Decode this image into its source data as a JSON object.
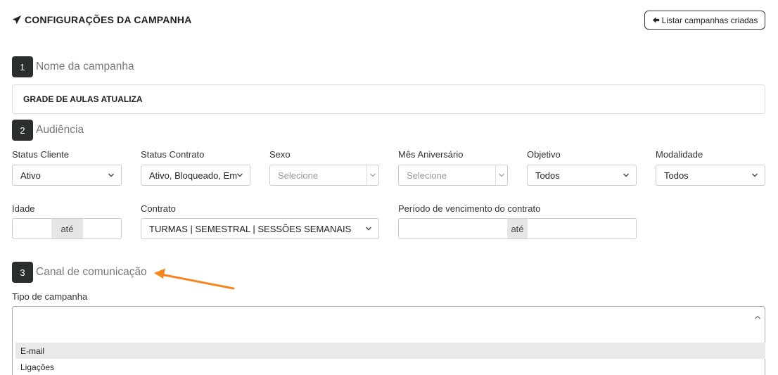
{
  "header": {
    "icon": "paper-plane-icon",
    "title": "CONFIGURAÇÕES DA CAMPANHA"
  },
  "list_button": {
    "icon": "arrow-left-icon",
    "label": "Listar campanhas criadas"
  },
  "steps": [
    {
      "number": "1",
      "title": "Nome da campanha"
    },
    {
      "number": "2",
      "title": "Audiência"
    },
    {
      "number": "3",
      "title": "Canal de comunicação"
    }
  ],
  "campaign_name": {
    "value": "GRADE DE AULAS ATUALIZA"
  },
  "audience": {
    "status_cliente": {
      "label": "Status Cliente",
      "value": "Ativo"
    },
    "status_contrato": {
      "label": "Status Contrato",
      "value": "Ativo, Bloqueado, Em"
    },
    "sexo": {
      "label": "Sexo",
      "placeholder": "Selecione"
    },
    "mes_aniversario": {
      "label": "Mês Aniversário",
      "placeholder": "Selecione"
    },
    "objetivo": {
      "label": "Objetivo",
      "value": "Todos"
    },
    "modalidade": {
      "label": "Modalidade",
      "value": "Todos"
    },
    "idade": {
      "label": "Idade",
      "separator": "até"
    },
    "contrato": {
      "label": "Contrato",
      "value": "TURMAS | SEMESTRAL | SESSÕES SEMANAIS"
    },
    "periodo": {
      "label": "Período de vencimento do contrato",
      "separator": "até"
    }
  },
  "channel": {
    "tipo_label": "Tipo de campanha",
    "options": [
      "E-mail",
      "Ligações"
    ],
    "highlighted_option": "E-mail"
  },
  "colors": {
    "step_badge": "#2b2f2c",
    "annotation_arrow": "#f5851f",
    "highlight": "#e9e9e9"
  }
}
